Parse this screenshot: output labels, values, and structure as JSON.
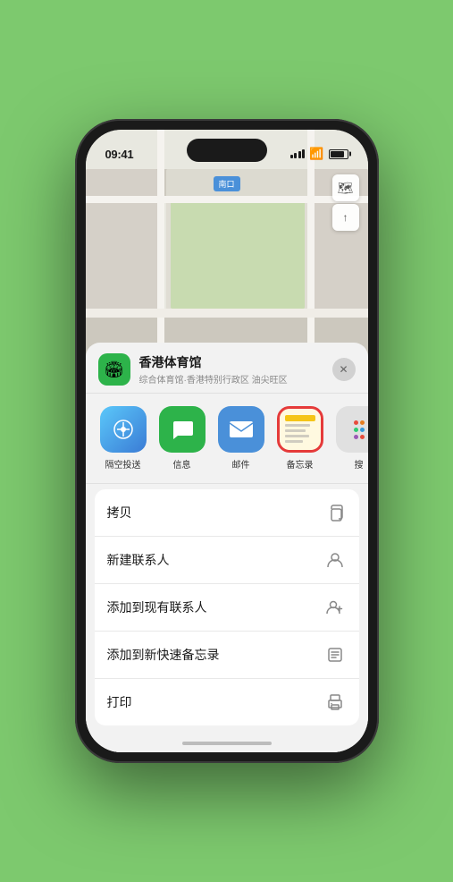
{
  "status_bar": {
    "time": "09:41",
    "location_arrow": "▶"
  },
  "map": {
    "location_label": "南口",
    "stadium_name": "香港体育馆",
    "controls": {
      "map_icon": "🗺",
      "location_icon": "⬆"
    }
  },
  "sheet": {
    "venue_icon": "🏟",
    "venue_name": "香港体育馆",
    "venue_desc": "综合体育馆·香港特别行政区 油尖旺区",
    "close_label": "✕"
  },
  "share_items": [
    {
      "id": "airdrop",
      "label": "隔空投送",
      "type": "airdrop"
    },
    {
      "id": "message",
      "label": "信息",
      "type": "message"
    },
    {
      "id": "mail",
      "label": "邮件",
      "type": "mail"
    },
    {
      "id": "notes",
      "label": "备忘录",
      "type": "notes"
    },
    {
      "id": "more",
      "label": "搜",
      "type": "more"
    }
  ],
  "actions": [
    {
      "id": "copy",
      "label": "拷贝",
      "icon": "copy"
    },
    {
      "id": "new-contact",
      "label": "新建联系人",
      "icon": "person"
    },
    {
      "id": "add-contact",
      "label": "添加到现有联系人",
      "icon": "person-add"
    },
    {
      "id": "quick-note",
      "label": "添加到新快速备忘录",
      "icon": "note"
    },
    {
      "id": "print",
      "label": "打印",
      "icon": "print"
    }
  ]
}
